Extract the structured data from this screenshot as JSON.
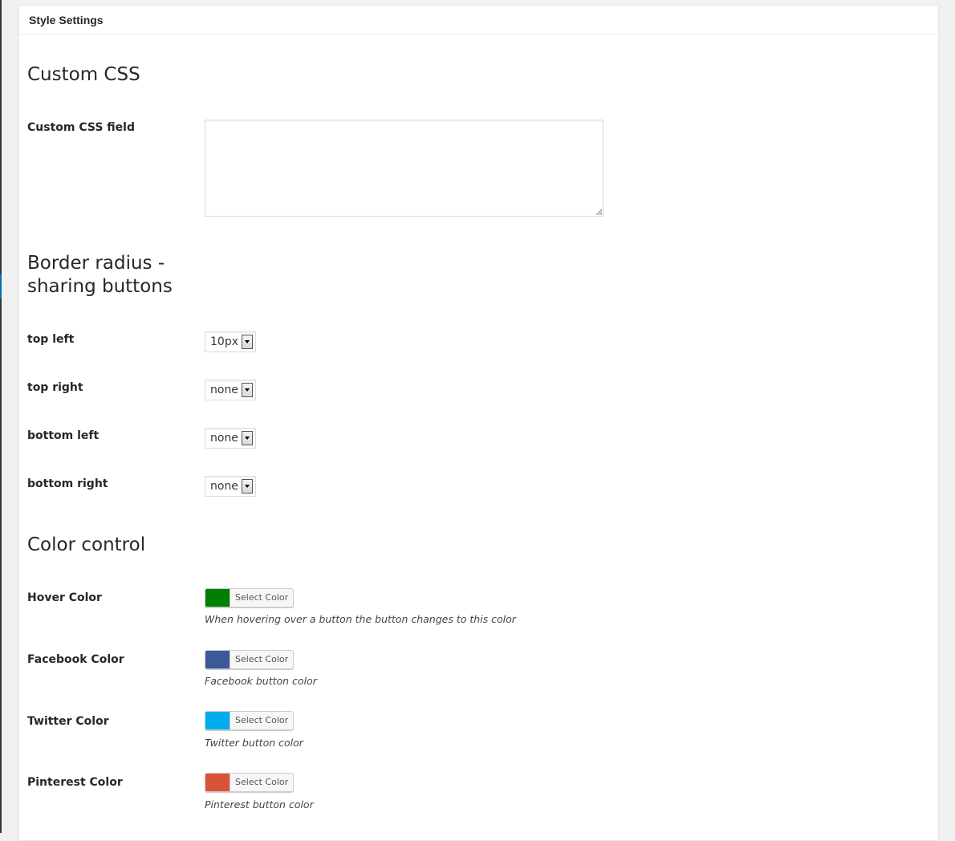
{
  "panel": {
    "title": "Style Settings"
  },
  "custom_css": {
    "heading": "Custom CSS",
    "field_label": "Custom CSS field",
    "value": ""
  },
  "border_radius": {
    "heading_line1": "Border radius -",
    "heading_line2": "sharing buttons",
    "fields": [
      {
        "label": "top left",
        "value": "10px"
      },
      {
        "label": "top right",
        "value": "none"
      },
      {
        "label": "bottom left",
        "value": "none"
      },
      {
        "label": "bottom right",
        "value": "none"
      }
    ]
  },
  "color_control": {
    "heading": "Color control",
    "button_label": "Select Color",
    "fields": [
      {
        "label": "Hover Color",
        "color": "#008000",
        "description": "When hovering over a button the button changes to this color"
      },
      {
        "label": "Facebook Color",
        "color": "#3b5998",
        "description": "Facebook button color"
      },
      {
        "label": "Twitter Color",
        "color": "#00aced",
        "description": "Twitter button color"
      },
      {
        "label": "Pinterest Color",
        "color": "#d9533a",
        "description": "Pinterest button color"
      }
    ]
  }
}
